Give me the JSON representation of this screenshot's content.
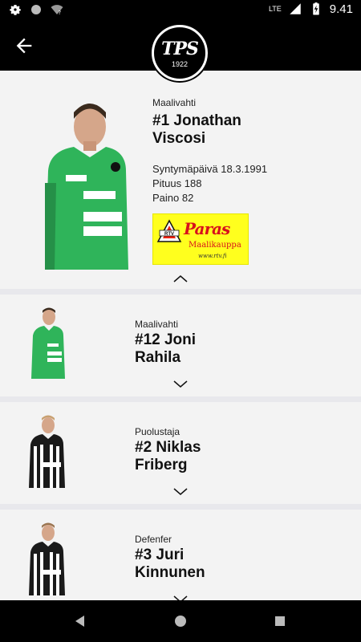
{
  "status_bar": {
    "network": "LTE",
    "time": "9.41",
    "icons": [
      "gear-icon",
      "circle-icon",
      "wifi-question-icon",
      "signal-icon",
      "battery-charging-icon"
    ]
  },
  "app_bar": {
    "back_icon": "arrow-back-icon",
    "logo_text": "TPS",
    "logo_year": "1922"
  },
  "players": [
    {
      "position": "Maalivahti",
      "number_name_line1": "#1 Jonathan",
      "number_name_line2": "Viscosi",
      "birth": "Syntymäpäivä 18.3.1991",
      "height": "Pituus 188",
      "weight": "Paino 82",
      "expanded": true,
      "shirt_color": "#2fb45a"
    },
    {
      "position": "Maalivahti",
      "number_name_line1": "#12 Joni",
      "number_name_line2": "Rahila",
      "expanded": false,
      "shirt_color": "#2fb45a"
    },
    {
      "position": "Puolustaja",
      "number_name_line1": "#2 Niklas",
      "number_name_line2": "Friberg",
      "expanded": false,
      "shirt_color": "#1a1a1a"
    },
    {
      "position": "Defenfer",
      "number_name_line1": "#3 Juri",
      "number_name_line2": "Kinnunen",
      "expanded": false,
      "shirt_color": "#1a1a1a"
    }
  ],
  "sponsor": {
    "brand": "Paras",
    "subtitle": "Maalikauppa",
    "url": "www.rtv.fi",
    "badge": "RTV"
  },
  "nav_bar": {
    "icons": [
      "back-triangle-icon",
      "home-circle-icon",
      "recents-square-icon"
    ]
  }
}
